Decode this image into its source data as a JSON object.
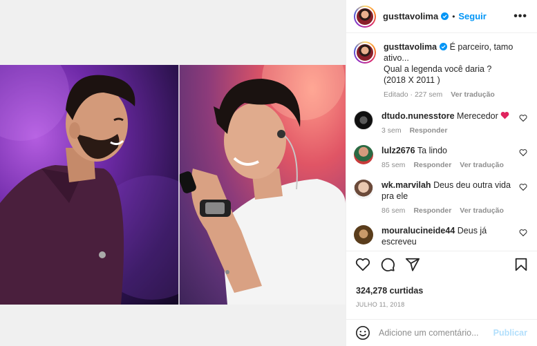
{
  "header": {
    "username": "gusttavolima",
    "separator": "•",
    "follow_label": "Seguir",
    "more_label": "•••"
  },
  "caption": {
    "username": "gusttavolima",
    "text_line1": "É parceiro, tamo ativo...",
    "text_line2": "Qual a legenda você daria ?",
    "text_line3": "(2018 X 2011 )",
    "meta_edited": "Editado · 227 sem",
    "see_translation": "Ver tradução"
  },
  "comments": [
    {
      "username": "dtudo.nunesstore",
      "text": "Merecedor",
      "has_heart_emoji": true,
      "age": "3 sem",
      "reply": "Responder",
      "translate": ""
    },
    {
      "username": "lulz2676",
      "text": "Ta lindo",
      "has_heart_emoji": false,
      "age": "85 sem",
      "reply": "Responder",
      "translate": "Ver tradução"
    },
    {
      "username": "wk.marvilah",
      "text": "Deus deu outra vida pra ele",
      "has_heart_emoji": false,
      "age": "86 sem",
      "reply": "Responder",
      "translate": "Ver tradução"
    },
    {
      "username": "mouralucineide44",
      "text": "Deus já escreveu",
      "has_heart_emoji": false,
      "age": "",
      "reply": "",
      "translate": ""
    }
  ],
  "stats": {
    "likes": "324,278 curtidas",
    "date": "JULHO 11, 2018"
  },
  "add_comment": {
    "placeholder": "Adicione um comentário...",
    "publish_label": "Publicar"
  },
  "icons": {
    "more": "more-icon",
    "verified": "verified-badge-icon",
    "like": "heart-icon",
    "comment": "comment-icon",
    "share": "share-icon",
    "save": "bookmark-icon",
    "emoji": "emoji-icon"
  },
  "colors": {
    "accent": "#0095f6",
    "publish_disabled": "#b2dffc",
    "muted": "#8e8e8e",
    "heart_emoji": "#e0245e"
  }
}
